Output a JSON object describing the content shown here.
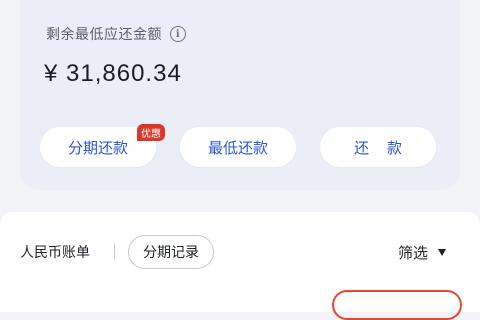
{
  "summary": {
    "label": "剩余最低应还金额",
    "info_icon": "i",
    "amount": "¥ 31,860.34"
  },
  "actions": {
    "installment": "分期还款",
    "promo_badge": "优惠",
    "minimum": "最低还款",
    "repay": "还款"
  },
  "bills": {
    "cny_tab": "人民币账单",
    "installment_records": "分期记录",
    "filter": "筛选"
  },
  "colors": {
    "accent": "#2d54d8",
    "badge": "#d9392b",
    "card_bg": "#eceef7"
  }
}
